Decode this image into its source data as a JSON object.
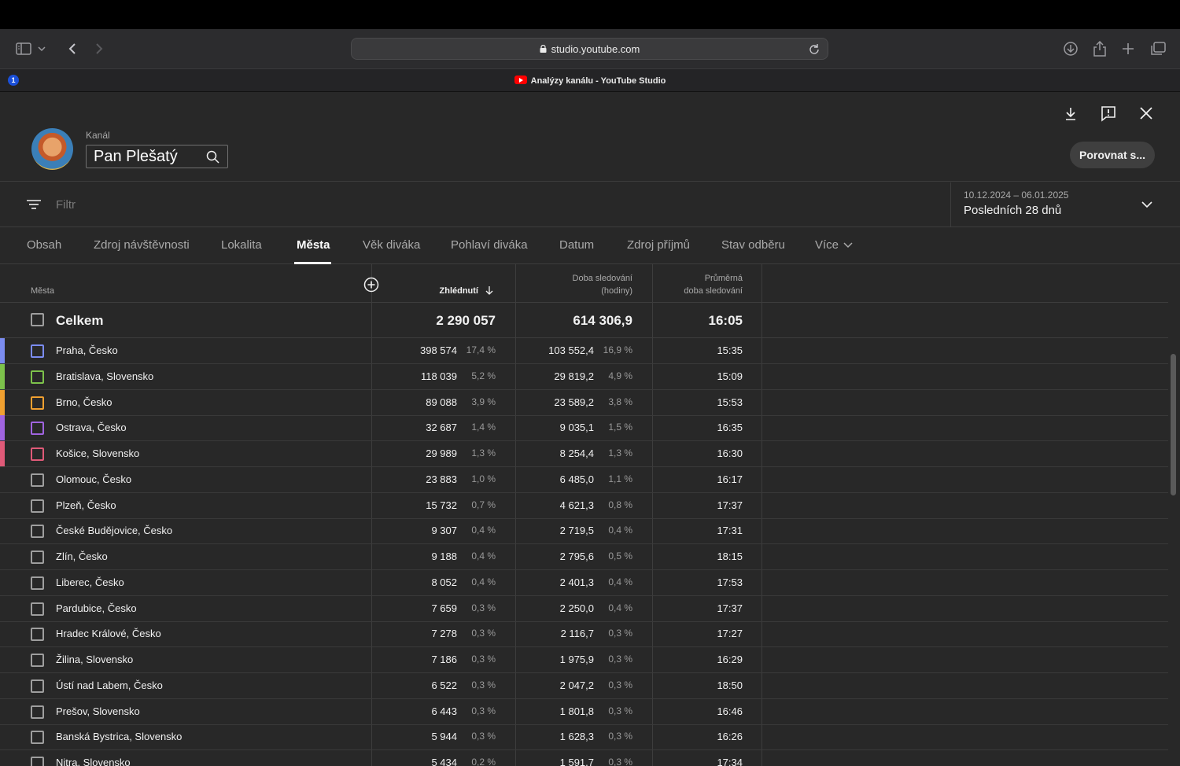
{
  "browser": {
    "url": "studio.youtube.com",
    "tab_title": "Analýzy kanálu - YouTube Studio",
    "password_icon": "1"
  },
  "header": {
    "channel_label": "Kanál",
    "channel_name": "Pan Plešatý",
    "compare_button": "Porovnat s..."
  },
  "filter": {
    "placeholder": "Filtr"
  },
  "date_range": {
    "dates": "10.12.2024 – 06.01.2025",
    "label": "Posledních 28 dnů"
  },
  "tabs": [
    "Obsah",
    "Zdroj návštěvnosti",
    "Lokalita",
    "Města",
    "Věk diváka",
    "Pohlaví diváka",
    "Datum",
    "Zdroj příjmů",
    "Stav odběru",
    "Více"
  ],
  "table": {
    "col_city": "Města",
    "col_views": "Zhlédnutí",
    "col_watch_1": "Doba sledování",
    "col_watch_2": "(hodiny)",
    "col_avg_1": "Průměrná",
    "col_avg_2": "doba sledování",
    "total": {
      "name": "Celkem",
      "views": "2 290 057",
      "watch": "614 306,9",
      "avg": "16:05"
    },
    "rows": [
      {
        "name": "Praha, Česko",
        "views": "398 574",
        "views_pct": "17,4 %",
        "watch": "103 552,4",
        "watch_pct": "16,9 %",
        "avg": "15:35",
        "color": "#7b8cf0"
      },
      {
        "name": "Bratislava, Slovensko",
        "views": "118 039",
        "views_pct": "5,2 %",
        "watch": "29 819,2",
        "watch_pct": "4,9 %",
        "avg": "15:09",
        "color": "#7dc24b"
      },
      {
        "name": "Brno, Česko",
        "views": "89 088",
        "views_pct": "3,9 %",
        "watch": "23 589,2",
        "watch_pct": "3,8 %",
        "avg": "15:53",
        "color": "#f0a030"
      },
      {
        "name": "Ostrava, Česko",
        "views": "32 687",
        "views_pct": "1,4 %",
        "watch": "9 035,1",
        "watch_pct": "1,5 %",
        "avg": "16:35",
        "color": "#a064e0"
      },
      {
        "name": "Košice, Slovensko",
        "views": "29 989",
        "views_pct": "1,3 %",
        "watch": "8 254,4",
        "watch_pct": "1,3 %",
        "avg": "16:30",
        "color": "#e05a78"
      },
      {
        "name": "Olomouc, Česko",
        "views": "23 883",
        "views_pct": "1,0 %",
        "watch": "6 485,0",
        "watch_pct": "1,1 %",
        "avg": "16:17",
        "color": ""
      },
      {
        "name": "Plzeň, Česko",
        "views": "15 732",
        "views_pct": "0,7 %",
        "watch": "4 621,3",
        "watch_pct": "0,8 %",
        "avg": "17:37",
        "color": ""
      },
      {
        "name": "České Budějovice, Česko",
        "views": "9 307",
        "views_pct": "0,4 %",
        "watch": "2 719,5",
        "watch_pct": "0,4 %",
        "avg": "17:31",
        "color": ""
      },
      {
        "name": "Zlín, Česko",
        "views": "9 188",
        "views_pct": "0,4 %",
        "watch": "2 795,6",
        "watch_pct": "0,5 %",
        "avg": "18:15",
        "color": ""
      },
      {
        "name": "Liberec, Česko",
        "views": "8 052",
        "views_pct": "0,4 %",
        "watch": "2 401,3",
        "watch_pct": "0,4 %",
        "avg": "17:53",
        "color": ""
      },
      {
        "name": "Pardubice, Česko",
        "views": "7 659",
        "views_pct": "0,3 %",
        "watch": "2 250,0",
        "watch_pct": "0,4 %",
        "avg": "17:37",
        "color": ""
      },
      {
        "name": "Hradec Králové, Česko",
        "views": "7 278",
        "views_pct": "0,3 %",
        "watch": "2 116,7",
        "watch_pct": "0,3 %",
        "avg": "17:27",
        "color": ""
      },
      {
        "name": "Žilina, Slovensko",
        "views": "7 186",
        "views_pct": "0,3 %",
        "watch": "1 975,9",
        "watch_pct": "0,3 %",
        "avg": "16:29",
        "color": ""
      },
      {
        "name": "Ústí nad Labem, Česko",
        "views": "6 522",
        "views_pct": "0,3 %",
        "watch": "2 047,2",
        "watch_pct": "0,3 %",
        "avg": "18:50",
        "color": ""
      },
      {
        "name": "Prešov, Slovensko",
        "views": "6 443",
        "views_pct": "0,3 %",
        "watch": "1 801,8",
        "watch_pct": "0,3 %",
        "avg": "16:46",
        "color": ""
      },
      {
        "name": "Banská Bystrica, Slovensko",
        "views": "5 944",
        "views_pct": "0,3 %",
        "watch": "1 628,3",
        "watch_pct": "0,3 %",
        "avg": "16:26",
        "color": ""
      },
      {
        "name": "Nitra, Slovensko",
        "views": "5 434",
        "views_pct": "0,2 %",
        "watch": "1 591,7",
        "watch_pct": "0,3 %",
        "avg": "17:34",
        "color": ""
      }
    ]
  }
}
